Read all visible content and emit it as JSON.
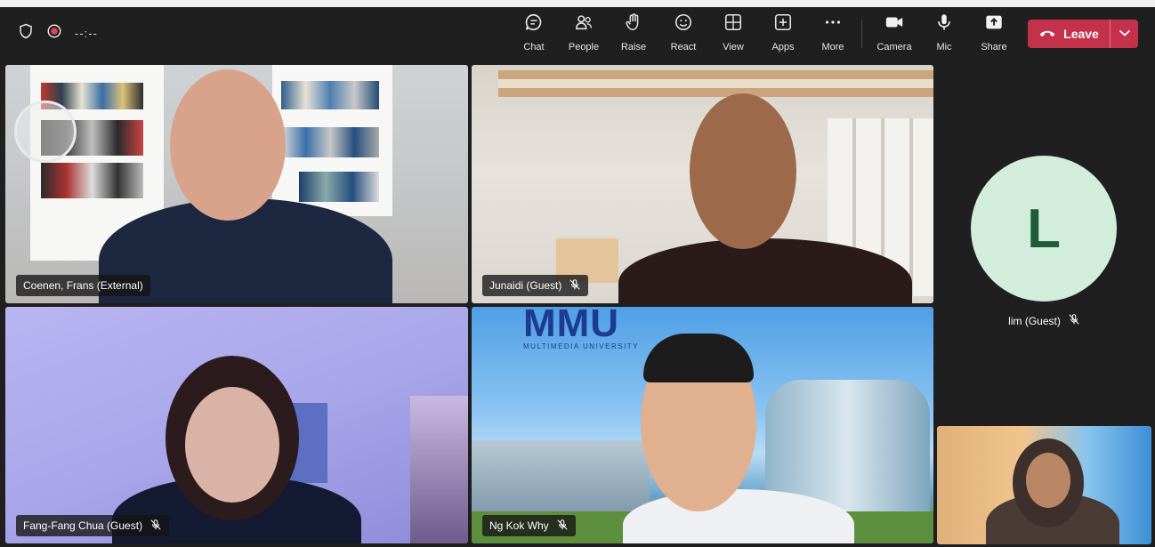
{
  "header": {
    "timer": "--:--",
    "tools": [
      {
        "label": "Chat",
        "icon": "chat-icon"
      },
      {
        "label": "People",
        "icon": "people-icon"
      },
      {
        "label": "Raise",
        "icon": "raise-hand-icon"
      },
      {
        "label": "React",
        "icon": "react-icon"
      },
      {
        "label": "View",
        "icon": "view-icon"
      },
      {
        "label": "Apps",
        "icon": "apps-icon"
      },
      {
        "label": "More",
        "icon": "more-icon"
      },
      {
        "label": "Camera",
        "icon": "camera-icon"
      },
      {
        "label": "Mic",
        "icon": "mic-icon"
      },
      {
        "label": "Share",
        "icon": "share-icon"
      }
    ],
    "leave_label": "Leave",
    "leave_color": "#c4314b"
  },
  "participants": [
    {
      "name": "Coenen, Frans (External)",
      "muted": false
    },
    {
      "name": "Junaidi (Guest)",
      "muted": true
    },
    {
      "name": "Fang-Fang Chua (Guest)",
      "muted": true
    },
    {
      "name": "Ng Kok Why",
      "muted": true
    },
    {
      "name": "lim (Guest)",
      "muted": true,
      "avatar_initial": "L",
      "avatar_color": "#d3eddd"
    }
  ],
  "backgrounds": {
    "mmu_logo": "MMU",
    "mmu_subtitle": "MULTIMEDIA UNIVERSITY"
  }
}
